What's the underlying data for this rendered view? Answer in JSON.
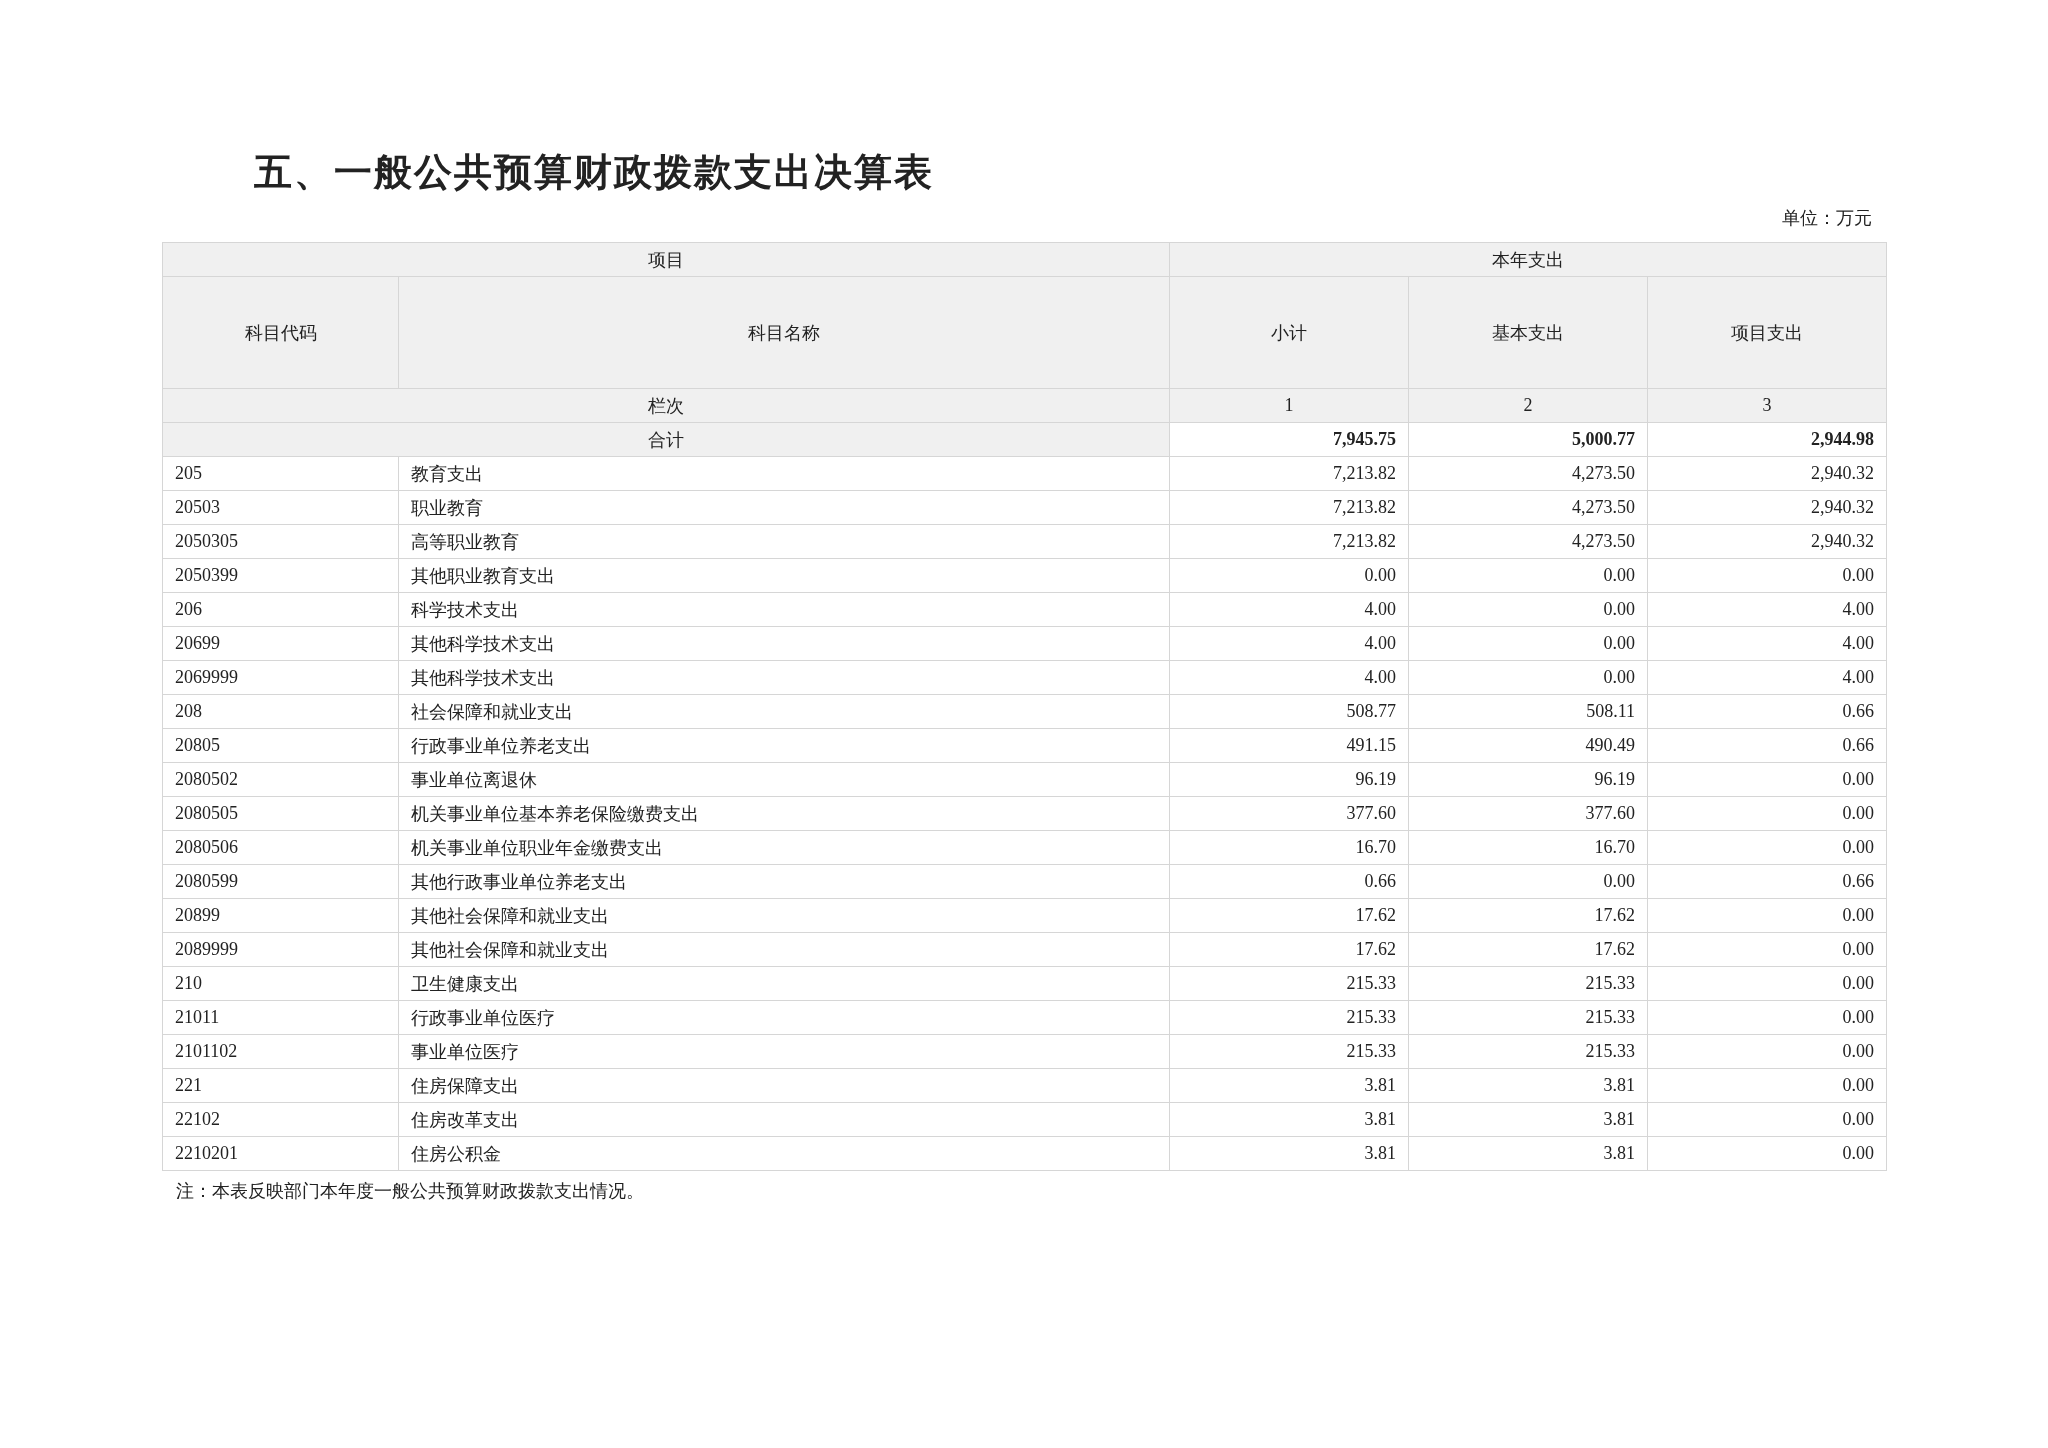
{
  "title": "五、一般公共预算财政拨款支出决算表",
  "unit": "单位：万元",
  "header": {
    "item_group": "项目",
    "year_group": "本年支出",
    "code": "科目代码",
    "name": "科目名称",
    "columns": [
      "小计",
      "基本支出",
      "项目支出"
    ]
  },
  "index_row": {
    "label": "栏次",
    "numbers": [
      "1",
      "2",
      "3"
    ]
  },
  "total_row": {
    "label": "合计",
    "values": [
      "7,945.75",
      "5,000.77",
      "2,944.98"
    ]
  },
  "rows": [
    {
      "code": "205",
      "name": "教育支出",
      "values": [
        "7,213.82",
        "4,273.50",
        "2,940.32"
      ]
    },
    {
      "code": "20503",
      "name": "职业教育",
      "values": [
        "7,213.82",
        "4,273.50",
        "2,940.32"
      ]
    },
    {
      "code": "2050305",
      "name": "高等职业教育",
      "values": [
        "7,213.82",
        "4,273.50",
        "2,940.32"
      ]
    },
    {
      "code": "2050399",
      "name": "其他职业教育支出",
      "values": [
        "0.00",
        "0.00",
        "0.00"
      ]
    },
    {
      "code": "206",
      "name": "科学技术支出",
      "values": [
        "4.00",
        "0.00",
        "4.00"
      ]
    },
    {
      "code": "20699",
      "name": "其他科学技术支出",
      "values": [
        "4.00",
        "0.00",
        "4.00"
      ]
    },
    {
      "code": "2069999",
      "name": "其他科学技术支出",
      "values": [
        "4.00",
        "0.00",
        "4.00"
      ]
    },
    {
      "code": "208",
      "name": "社会保障和就业支出",
      "values": [
        "508.77",
        "508.11",
        "0.66"
      ]
    },
    {
      "code": "20805",
      "name": "行政事业单位养老支出",
      "values": [
        "491.15",
        "490.49",
        "0.66"
      ]
    },
    {
      "code": "2080502",
      "name": "事业单位离退休",
      "values": [
        "96.19",
        "96.19",
        "0.00"
      ]
    },
    {
      "code": "2080505",
      "name": "机关事业单位基本养老保险缴费支出",
      "values": [
        "377.60",
        "377.60",
        "0.00"
      ]
    },
    {
      "code": "2080506",
      "name": "机关事业单位职业年金缴费支出",
      "values": [
        "16.70",
        "16.70",
        "0.00"
      ]
    },
    {
      "code": "2080599",
      "name": "其他行政事业单位养老支出",
      "values": [
        "0.66",
        "0.00",
        "0.66"
      ]
    },
    {
      "code": "20899",
      "name": "其他社会保障和就业支出",
      "values": [
        "17.62",
        "17.62",
        "0.00"
      ]
    },
    {
      "code": "2089999",
      "name": "其他社会保障和就业支出",
      "values": [
        "17.62",
        "17.62",
        "0.00"
      ]
    },
    {
      "code": "210",
      "name": "卫生健康支出",
      "values": [
        "215.33",
        "215.33",
        "0.00"
      ]
    },
    {
      "code": "21011",
      "name": "行政事业单位医疗",
      "values": [
        "215.33",
        "215.33",
        "0.00"
      ]
    },
    {
      "code": "2101102",
      "name": "事业单位医疗",
      "values": [
        "215.33",
        "215.33",
        "0.00"
      ]
    },
    {
      "code": "221",
      "name": "住房保障支出",
      "values": [
        "3.81",
        "3.81",
        "0.00"
      ]
    },
    {
      "code": "22102",
      "name": "住房改革支出",
      "values": [
        "3.81",
        "3.81",
        "0.00"
      ]
    },
    {
      "code": "2210201",
      "name": "住房公积金",
      "values": [
        "3.81",
        "3.81",
        "0.00"
      ]
    }
  ],
  "note": "注：本表反映部门本年度一般公共预算财政拨款支出情况。"
}
